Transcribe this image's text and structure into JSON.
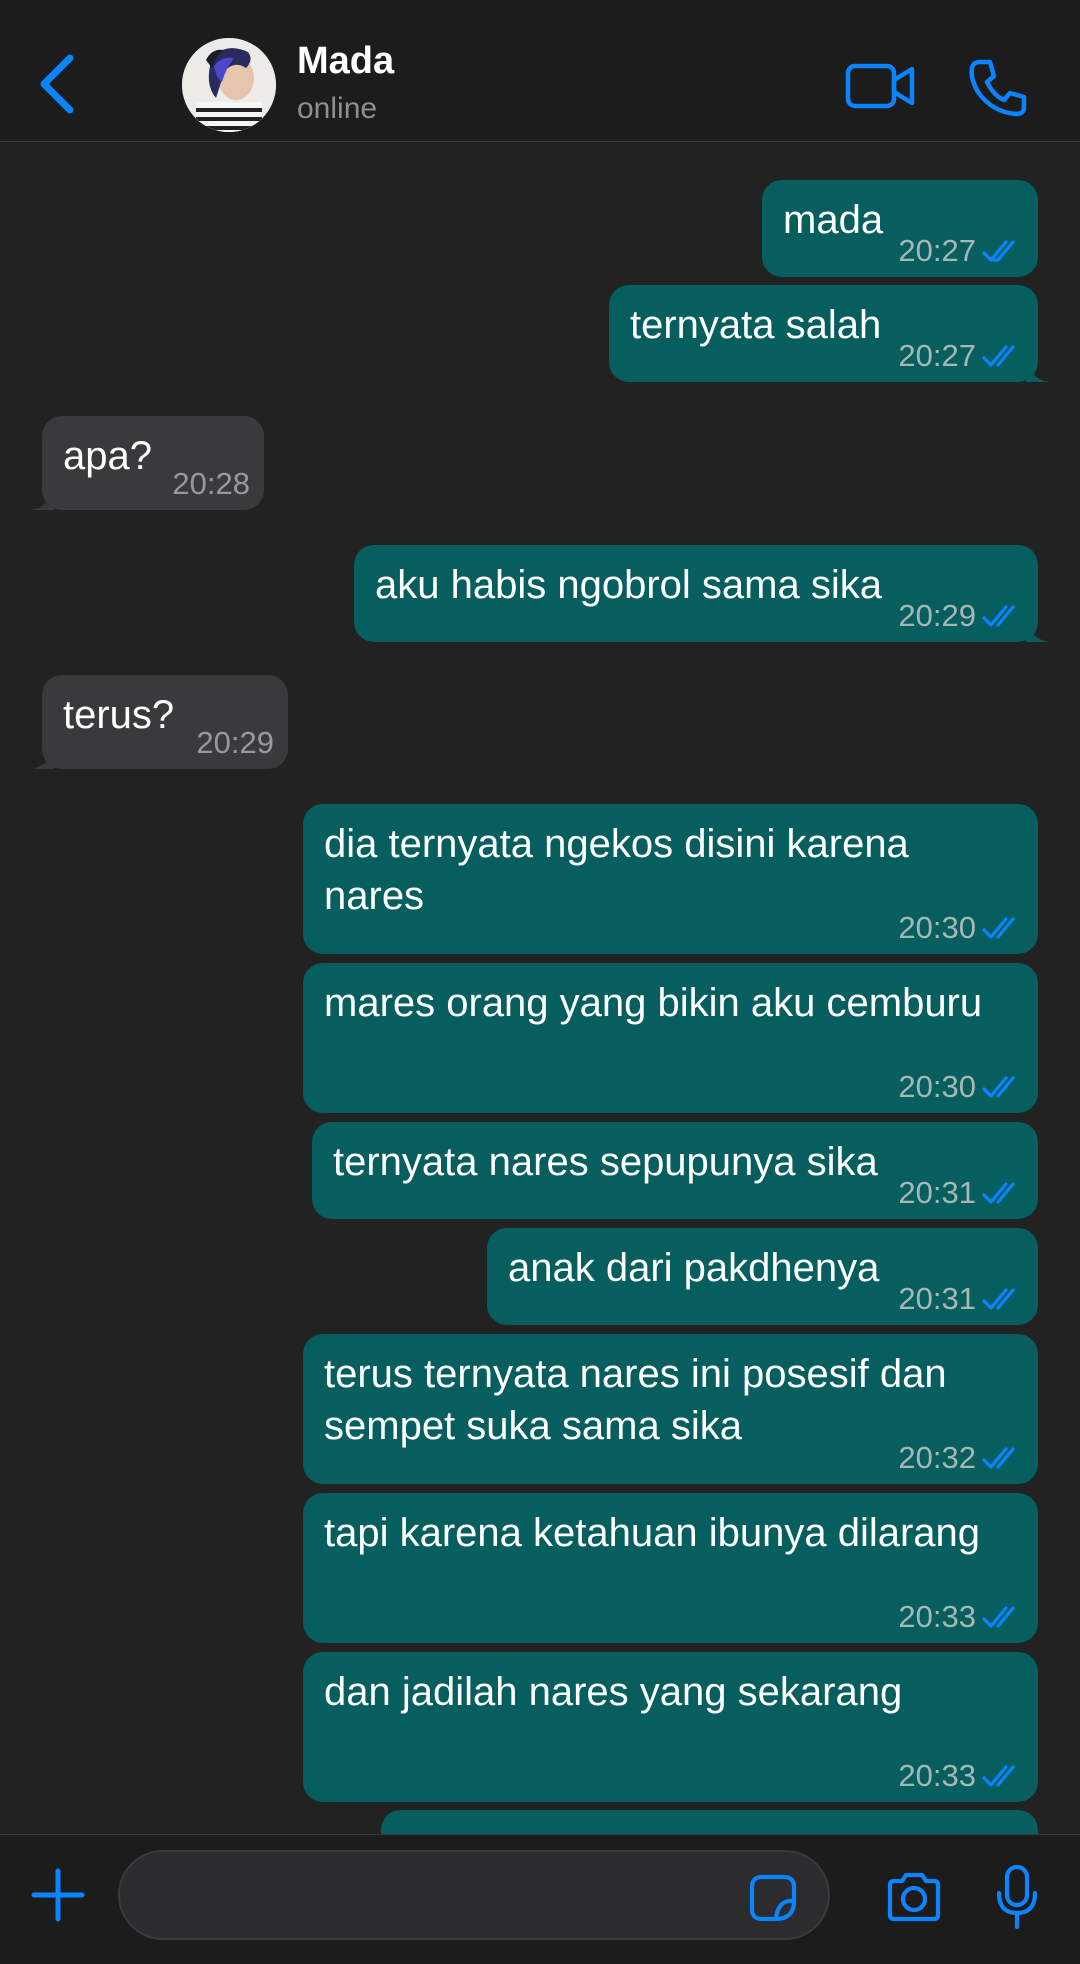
{
  "header": {
    "name": "Mada",
    "status": "online",
    "accent_color": "#0a84ff"
  },
  "messages": [
    {
      "dir": "out",
      "text": "mada",
      "time": "20:27"
    },
    {
      "dir": "out",
      "text": "ternyata salah",
      "time": "20:27"
    },
    {
      "dir": "in",
      "text": "apa?",
      "time": "20:28"
    },
    {
      "dir": "out",
      "text": "aku habis ngobrol sama sika",
      "time": "20:29"
    },
    {
      "dir": "in",
      "text": "terus?",
      "time": "20:29"
    },
    {
      "dir": "out",
      "text": "dia ternyata ngekos disini karena nares",
      "lines": [
        "dia ternyata ngekos disini karena",
        "nares"
      ],
      "time": "20:30"
    },
    {
      "dir": "out",
      "text": "mares orang yang bikin aku cemburu",
      "time": "20:30"
    },
    {
      "dir": "out",
      "text": "ternyata nares sepupunya sika",
      "time": "20:31"
    },
    {
      "dir": "out",
      "text": "anak dari pakdhenya",
      "time": "20:31"
    },
    {
      "dir": "out",
      "text": "terus ternyata nares ini posesif dan sempet suka sama sika",
      "lines": [
        "terus ternyata nares ini posesif dan",
        "sempet suka sama sika"
      ],
      "time": "20:32"
    },
    {
      "dir": "out",
      "text": "tapi karena ketahuan ibunya dilarang",
      "time": "20:33"
    },
    {
      "dir": "out",
      "text": "dan jadilah nares yang sekarang",
      "time": "20:33"
    }
  ],
  "composer": {
    "value": "",
    "placeholder": ""
  },
  "icons": {
    "back": "chevron-left-icon",
    "video": "video-camera-icon",
    "call": "phone-icon",
    "plus": "plus-icon",
    "sticker": "sticker-icon",
    "camera": "camera-icon",
    "mic": "microphone-icon"
  }
}
